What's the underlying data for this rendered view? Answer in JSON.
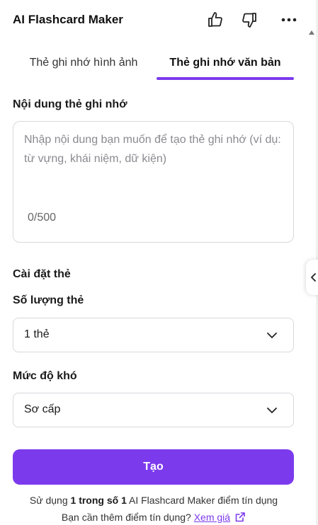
{
  "header": {
    "title": "AI Flashcard Maker",
    "icons": [
      "thumbs-up-icon",
      "thumbs-down-icon",
      "more-icon"
    ]
  },
  "tabs": [
    {
      "label": "Thẻ ghi nhớ hình ảnh",
      "active": false
    },
    {
      "label": "Thẻ ghi nhớ văn bản",
      "active": true
    }
  ],
  "content": {
    "label": "Nội dung thẻ ghi nhớ",
    "placeholder": "Nhập nội dung bạn muốn để tạo thẻ ghi nhớ (ví dụ: từ vựng, khái niệm, dữ kiện)",
    "value": "",
    "counter": "0/500"
  },
  "settings": {
    "title": "Cài đặt thẻ",
    "count_label": "Số lượng thẻ",
    "count_value": "1 thẻ",
    "difficulty_label": "Mức độ khó",
    "difficulty_value": "Sơ cấp"
  },
  "create_button": "Tạo",
  "footer": {
    "usage_prefix": "Sử dụng",
    "usage_bold": "1 trong số 1",
    "usage_suffix": "AI Flashcard Maker điểm tín dụng",
    "need_more": "Bạn cần thêm điểm tín dụng?",
    "price_link": "Xem giá"
  },
  "colors": {
    "accent": "#7c3aed",
    "border": "#d9d9de"
  }
}
